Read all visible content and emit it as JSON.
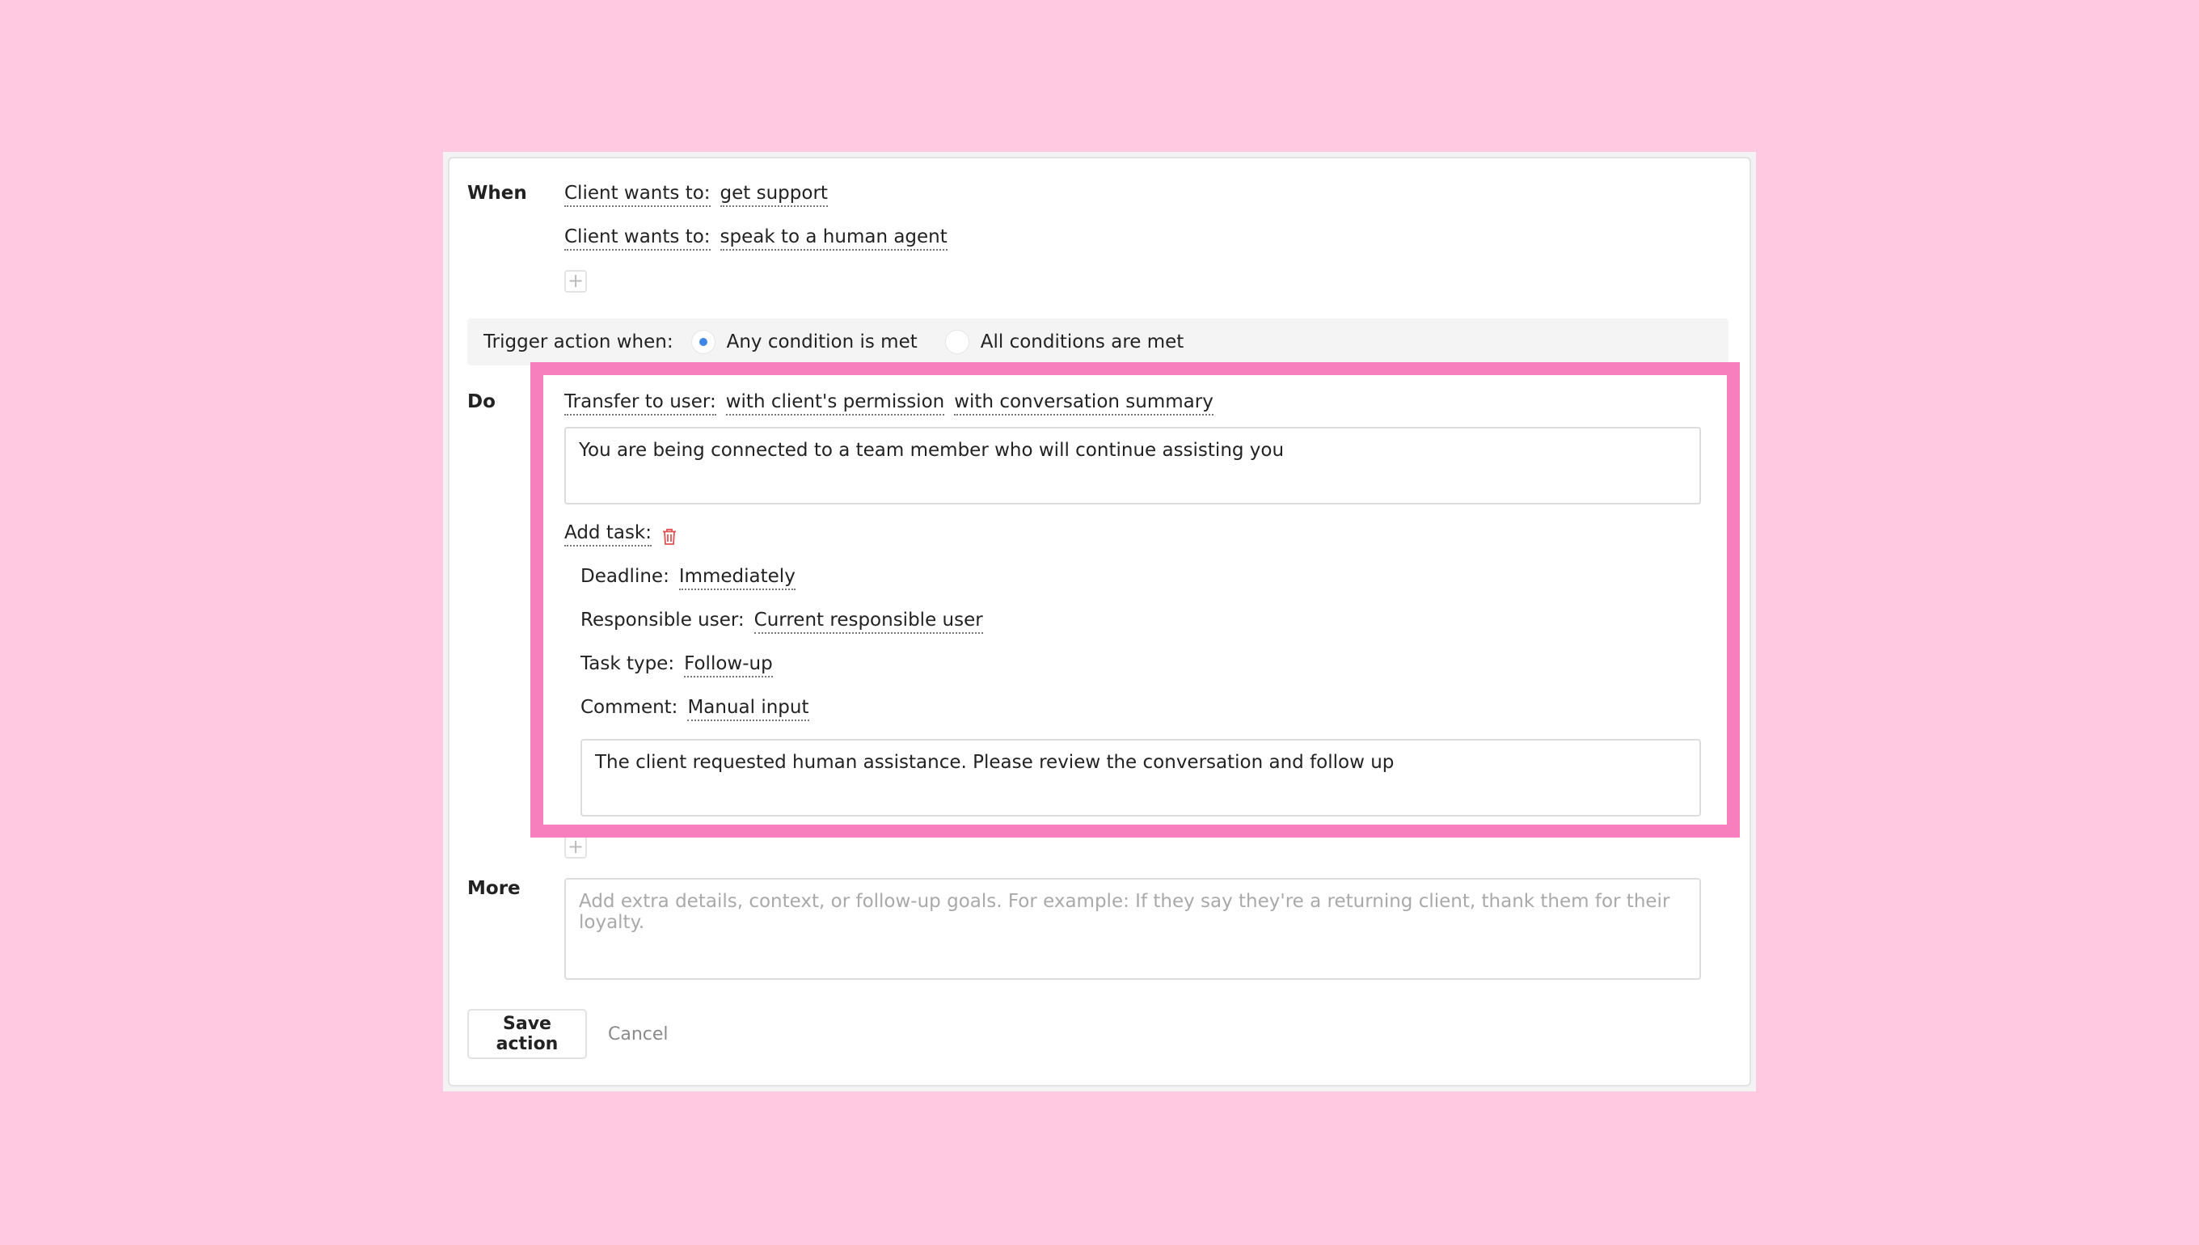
{
  "when": {
    "label": "When",
    "conditions": [
      {
        "field_label": "Client wants to:",
        "value": "get support"
      },
      {
        "field_label": "Client wants to:",
        "value": "speak to a human agent"
      }
    ],
    "add_symbol": "+"
  },
  "trigger": {
    "label": "Trigger action when:",
    "options": [
      {
        "label": "Any condition is met",
        "selected": true
      },
      {
        "label": "All conditions are met",
        "selected": false
      }
    ]
  },
  "do": {
    "label": "Do",
    "transfer": {
      "label": "Transfer to user:",
      "option_permission": "with client's permission",
      "option_summary": "with conversation summary",
      "message": "You are being connected to a team member who will continue assisting you"
    },
    "task": {
      "label": "Add task:",
      "deadline_label": "Deadline:",
      "deadline_value": "Immediately",
      "responsible_label": "Responsible user:",
      "responsible_value": "Current responsible user",
      "type_label": "Task type:",
      "type_value": "Follow-up",
      "comment_label": "Comment:",
      "comment_value": "Manual input",
      "comment_text": "The client requested human assistance. Please review the conversation and follow up"
    }
  },
  "more": {
    "label": "More",
    "placeholder": "Add extra details, context, or follow-up goals. For example: If they say they're a returning client, thank them for their loyalty."
  },
  "actions": {
    "save_label": "Save action",
    "cancel_label": "Cancel"
  },
  "colors": {
    "background": "#ffc9e1",
    "highlight": "#f77fbe",
    "radio_selected": "#3e86e6",
    "trash": "#e05252"
  }
}
